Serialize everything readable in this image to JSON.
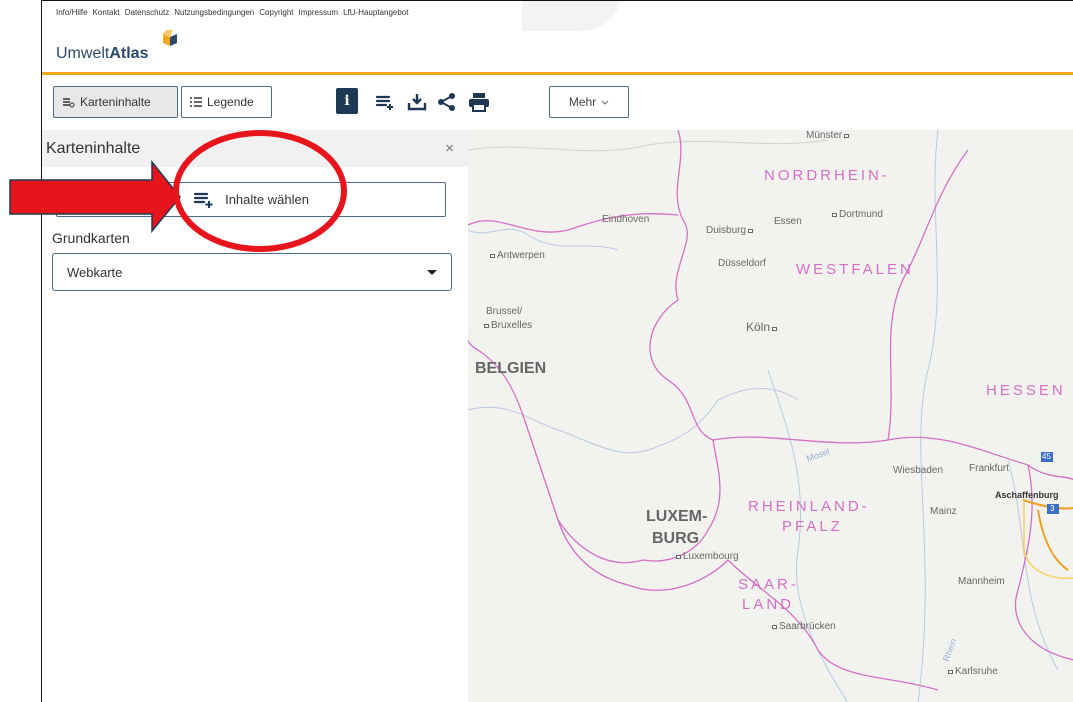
{
  "top_links": [
    "Info/Hilfe",
    "Kontakt",
    "Datenschutz",
    "Nutzungsbedingungen",
    "Copyright",
    "Impressum",
    "LfU-Hauptangebot"
  ],
  "brand": {
    "prefix": "Umwelt",
    "suffix": "Atlas"
  },
  "toolbar": {
    "karteninhalte": "Karteninhalte",
    "legende": "Legende",
    "mehr": "Mehr",
    "icons": [
      "info-icon",
      "add-layers-icon",
      "download-icon",
      "share-icon",
      "print-icon"
    ]
  },
  "panel": {
    "title": "Karteninhalte",
    "close": "×",
    "inhalte_button": "Inhalte wählen",
    "grundkarten_label": "Grundkarten",
    "grundkarten_value": "Webkarte"
  },
  "map": {
    "cities": [
      "Münster",
      "Eindhoven",
      "Essen",
      "Dortmund",
      "Duisburg",
      "Antwerpen",
      "Düsseldorf",
      "Brussel/",
      "Bruxelles",
      "Köln",
      "Wiesbaden",
      "Frankfurt",
      "Aschaffenburg",
      "Mainz",
      "Luxembourg",
      "Mannheim",
      "Saarbrücken",
      "Karlsruhe",
      "Mosel",
      "Rhein"
    ],
    "regions": [
      "NORDRHEIN-",
      "WESTFALEN",
      "HESSEN",
      "RHEINLAND-",
      "PFALZ",
      "SAAR-",
      "LAND"
    ],
    "countries": [
      "BELGIEN",
      "LUXEM-",
      "BURG"
    ],
    "shields": [
      "45",
      "3"
    ]
  },
  "colors": {
    "accent": "#f2a81d",
    "brand": "#2c4a6b",
    "annotation": "#e8141c",
    "border": "#d46fc8"
  }
}
